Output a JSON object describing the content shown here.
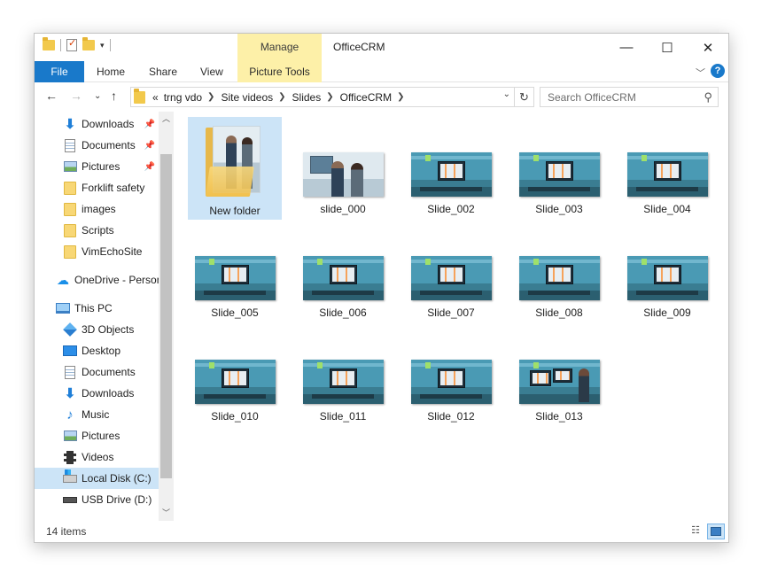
{
  "window": {
    "title": "OfficeCRM",
    "contextual_group": "Manage",
    "caption": {
      "minimize": "—",
      "maximize": "☐",
      "close": "✕"
    }
  },
  "ribbon": {
    "tabs": [
      {
        "label": "File",
        "accent": "#1979ca"
      },
      {
        "label": "Home"
      },
      {
        "label": "Share"
      },
      {
        "label": "View"
      },
      {
        "label": "Picture Tools",
        "accent": "#fdf0a8"
      }
    ],
    "help": "?"
  },
  "address": {
    "overflow": "«",
    "crumbs": [
      "trng vdo",
      "Site videos",
      "Slides",
      "OfficeCRM"
    ]
  },
  "search": {
    "placeholder": "Search OfficeCRM"
  },
  "navigation": {
    "quick_access": [
      {
        "label": "Downloads",
        "icon": "download-arrow-icon",
        "pinned": true
      },
      {
        "label": "Documents",
        "icon": "documents-icon",
        "pinned": true
      },
      {
        "label": "Pictures",
        "icon": "pictures-icon",
        "pinned": true
      },
      {
        "label": "Forklift safety",
        "icon": "folder-icon"
      },
      {
        "label": "images",
        "icon": "folder-icon"
      },
      {
        "label": "Scripts",
        "icon": "folder-icon"
      },
      {
        "label": "VimEchoSite",
        "icon": "folder-icon"
      }
    ],
    "onedrive": {
      "label": "OneDrive - Person",
      "icon": "onedrive-cloud-icon"
    },
    "this_pc": {
      "label": "This PC",
      "icon": "computer-icon"
    },
    "pc_items": [
      {
        "label": "3D Objects",
        "icon": "3d-objects-icon"
      },
      {
        "label": "Desktop",
        "icon": "desktop-icon"
      },
      {
        "label": "Documents",
        "icon": "documents-icon"
      },
      {
        "label": "Downloads",
        "icon": "download-arrow-icon"
      },
      {
        "label": "Music",
        "icon": "music-note-icon"
      },
      {
        "label": "Pictures",
        "icon": "pictures-icon"
      },
      {
        "label": "Videos",
        "icon": "videos-icon"
      },
      {
        "label": "Local Disk (C:)",
        "icon": "local-disk-icon",
        "selected": true
      },
      {
        "label": "USB Drive (D:)",
        "icon": "usb-drive-icon"
      }
    ]
  },
  "files": [
    {
      "name": "New folder",
      "kind": "folder",
      "selected": true
    },
    {
      "name": "slide_000",
      "kind": "image"
    },
    {
      "name": "Slide_002",
      "kind": "slide"
    },
    {
      "name": "Slide_003",
      "kind": "slide"
    },
    {
      "name": "Slide_004",
      "kind": "slide"
    },
    {
      "name": "Slide_005",
      "kind": "slide"
    },
    {
      "name": "Slide_006",
      "kind": "slide"
    },
    {
      "name": "Slide_007",
      "kind": "slide"
    },
    {
      "name": "Slide_008",
      "kind": "slide"
    },
    {
      "name": "Slide_009",
      "kind": "slide"
    },
    {
      "name": "Slide_010",
      "kind": "slide"
    },
    {
      "name": "Slide_011",
      "kind": "slide"
    },
    {
      "name": "Slide_012",
      "kind": "slide"
    },
    {
      "name": "Slide_013",
      "kind": "slide-person"
    }
  ],
  "status": {
    "item_count": "14 items"
  }
}
